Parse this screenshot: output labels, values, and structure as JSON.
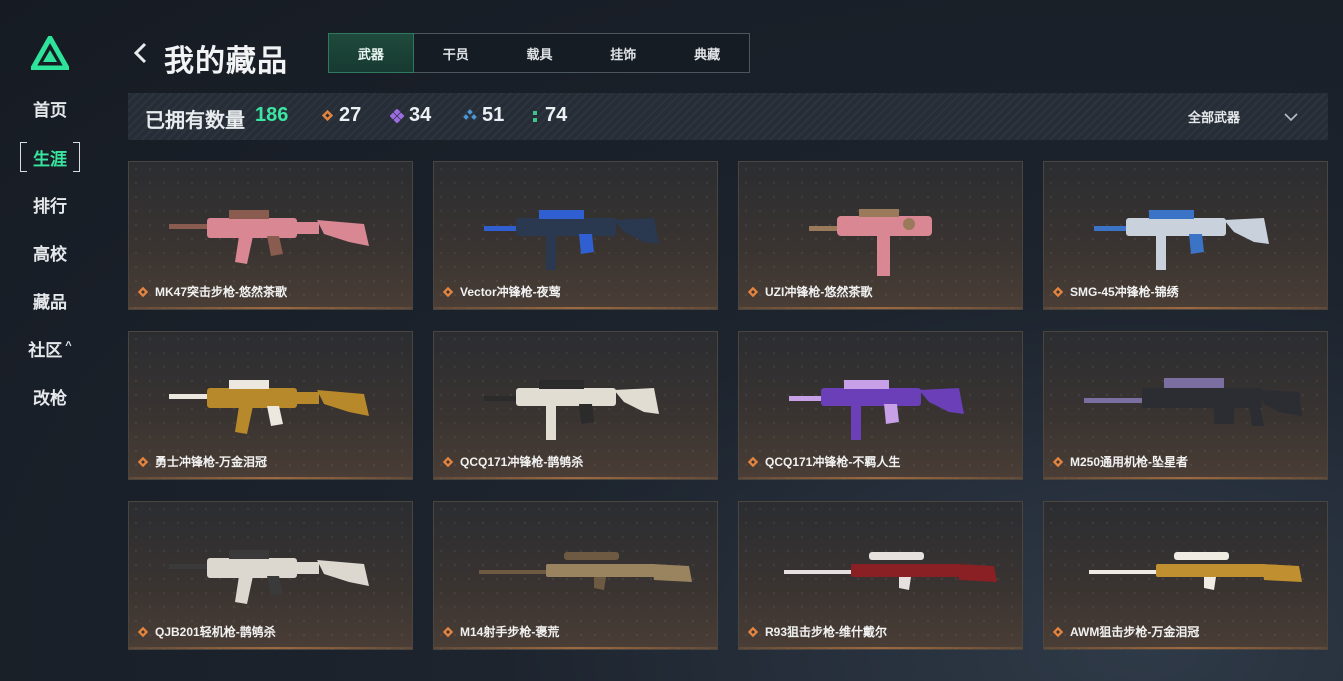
{
  "sidebar": {
    "logo": "app-logo-triangle",
    "items": [
      {
        "label": "首页",
        "active": false
      },
      {
        "label": "生涯",
        "active": true
      },
      {
        "label": "排行",
        "active": false
      },
      {
        "label": "高校",
        "active": false
      },
      {
        "label": "藏品",
        "active": false
      },
      {
        "label": "社区",
        "active": false,
        "caret": "^"
      },
      {
        "label": "改枪",
        "active": false
      }
    ]
  },
  "header": {
    "title": "我的藏品",
    "tabs": [
      {
        "label": "武器",
        "active": true
      },
      {
        "label": "干员",
        "active": false
      },
      {
        "label": "载具",
        "active": false
      },
      {
        "label": "挂饰",
        "active": false
      },
      {
        "label": "典藏",
        "active": false
      }
    ]
  },
  "stats": {
    "owned_label": "已拥有数量",
    "owned_count": "186",
    "rarities": [
      {
        "icon": "orange-diamond-icon",
        "color": "#e3843f",
        "count": "27"
      },
      {
        "icon": "purple-diamond-icon",
        "color": "#9a6ce0",
        "count": "34"
      },
      {
        "icon": "blue-diamond-icon",
        "color": "#4a97d8",
        "count": "51"
      },
      {
        "icon": "green-dots-icon",
        "color": "#3cc48a",
        "count": "74"
      }
    ],
    "filter_label": "全部武器"
  },
  "weapons": [
    {
      "name": "MK47突击步枪-悠然茶歌",
      "kind": "rifle",
      "body": "#d98792",
      "accent": "#8a5c4f"
    },
    {
      "name": "Vector冲锋枪-夜莺",
      "kind": "smg",
      "body": "#2a3850",
      "accent": "#2f5fd0"
    },
    {
      "name": "UZI冲锋枪-悠然茶歌",
      "kind": "uzi",
      "body": "#d98792",
      "accent": "#9a7a5a"
    },
    {
      "name": "SMG-45冲锋枪-锦绣",
      "kind": "smg",
      "body": "#c9d2dc",
      "accent": "#3b74c6"
    },
    {
      "name": "勇士冲锋枪-万金泪冠",
      "kind": "rifle",
      "body": "#b8892a",
      "accent": "#ece7df"
    },
    {
      "name": "QCQ171冲锋枪-鹊鸲杀",
      "kind": "smg",
      "body": "#e2ddd2",
      "accent": "#2b2b2b"
    },
    {
      "name": "QCQ171冲锋枪-不羁人生",
      "kind": "smg",
      "body": "#6a3fb8",
      "accent": "#c7a0e8"
    },
    {
      "name": "M250通用机枪-坠星者",
      "kind": "lmg",
      "body": "#2b2d33",
      "accent": "#7a6fa0"
    },
    {
      "name": "QJB201轻机枪-鹊鸲杀",
      "kind": "rifle",
      "body": "#dcd8d0",
      "accent": "#3a3a3a"
    },
    {
      "name": "M14射手步枪-褒荒",
      "kind": "sniper",
      "body": "#9a8460",
      "accent": "#6e5a42"
    },
    {
      "name": "R93狙击步枪-维什戴尔",
      "kind": "sniper",
      "body": "#8a1f24",
      "accent": "#e6e0de"
    },
    {
      "name": "AWM狙击步枪-万金泪冠",
      "kind": "sniper",
      "body": "#c09030",
      "accent": "#f0ece4"
    }
  ]
}
